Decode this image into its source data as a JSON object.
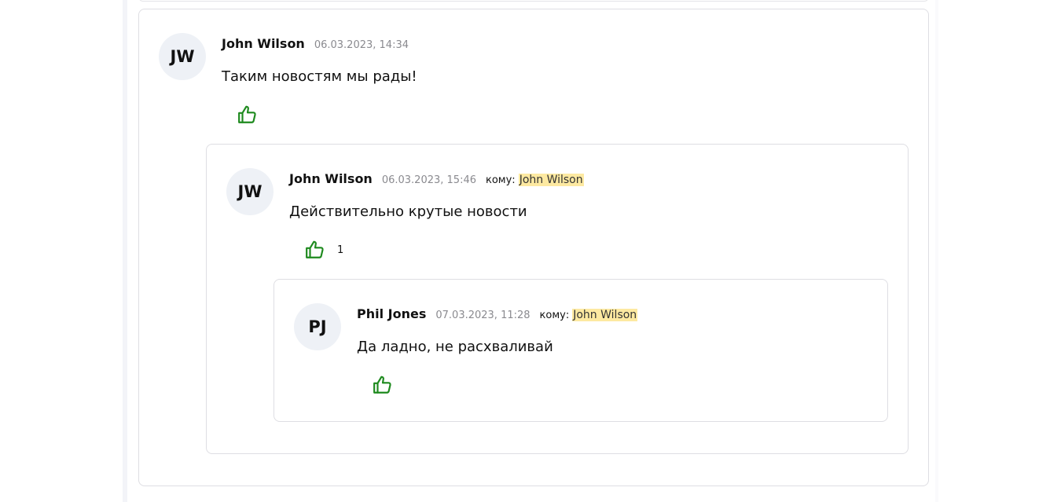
{
  "colors": {
    "like_icon": "#1e8a1e",
    "mention_highlight": "#fde9a1",
    "avatar_bg": "#eef1f6",
    "card_border": "#dedee3"
  },
  "comments": [
    {
      "initials": "JW",
      "author": "John Wilson",
      "date": "06.03.2023, 14:34",
      "text": "Таким новостям мы рады!",
      "like_icon": "thumbs-up-icon",
      "likes": ""
    },
    {
      "initials": "JW",
      "author": "John Wilson",
      "date": "06.03.2023, 15:46",
      "to_label": "кому:",
      "to_name": "John Wilson",
      "text": "Действительно крутые новости",
      "like_icon": "thumbs-up-icon",
      "likes": "1"
    },
    {
      "initials": "PJ",
      "author": "Phil Jones",
      "date": "07.03.2023, 11:28",
      "to_label": "кому:",
      "to_name": "John Wilson",
      "text": "Да ладно, не расхваливай",
      "like_icon": "thumbs-up-icon",
      "likes": ""
    }
  ]
}
